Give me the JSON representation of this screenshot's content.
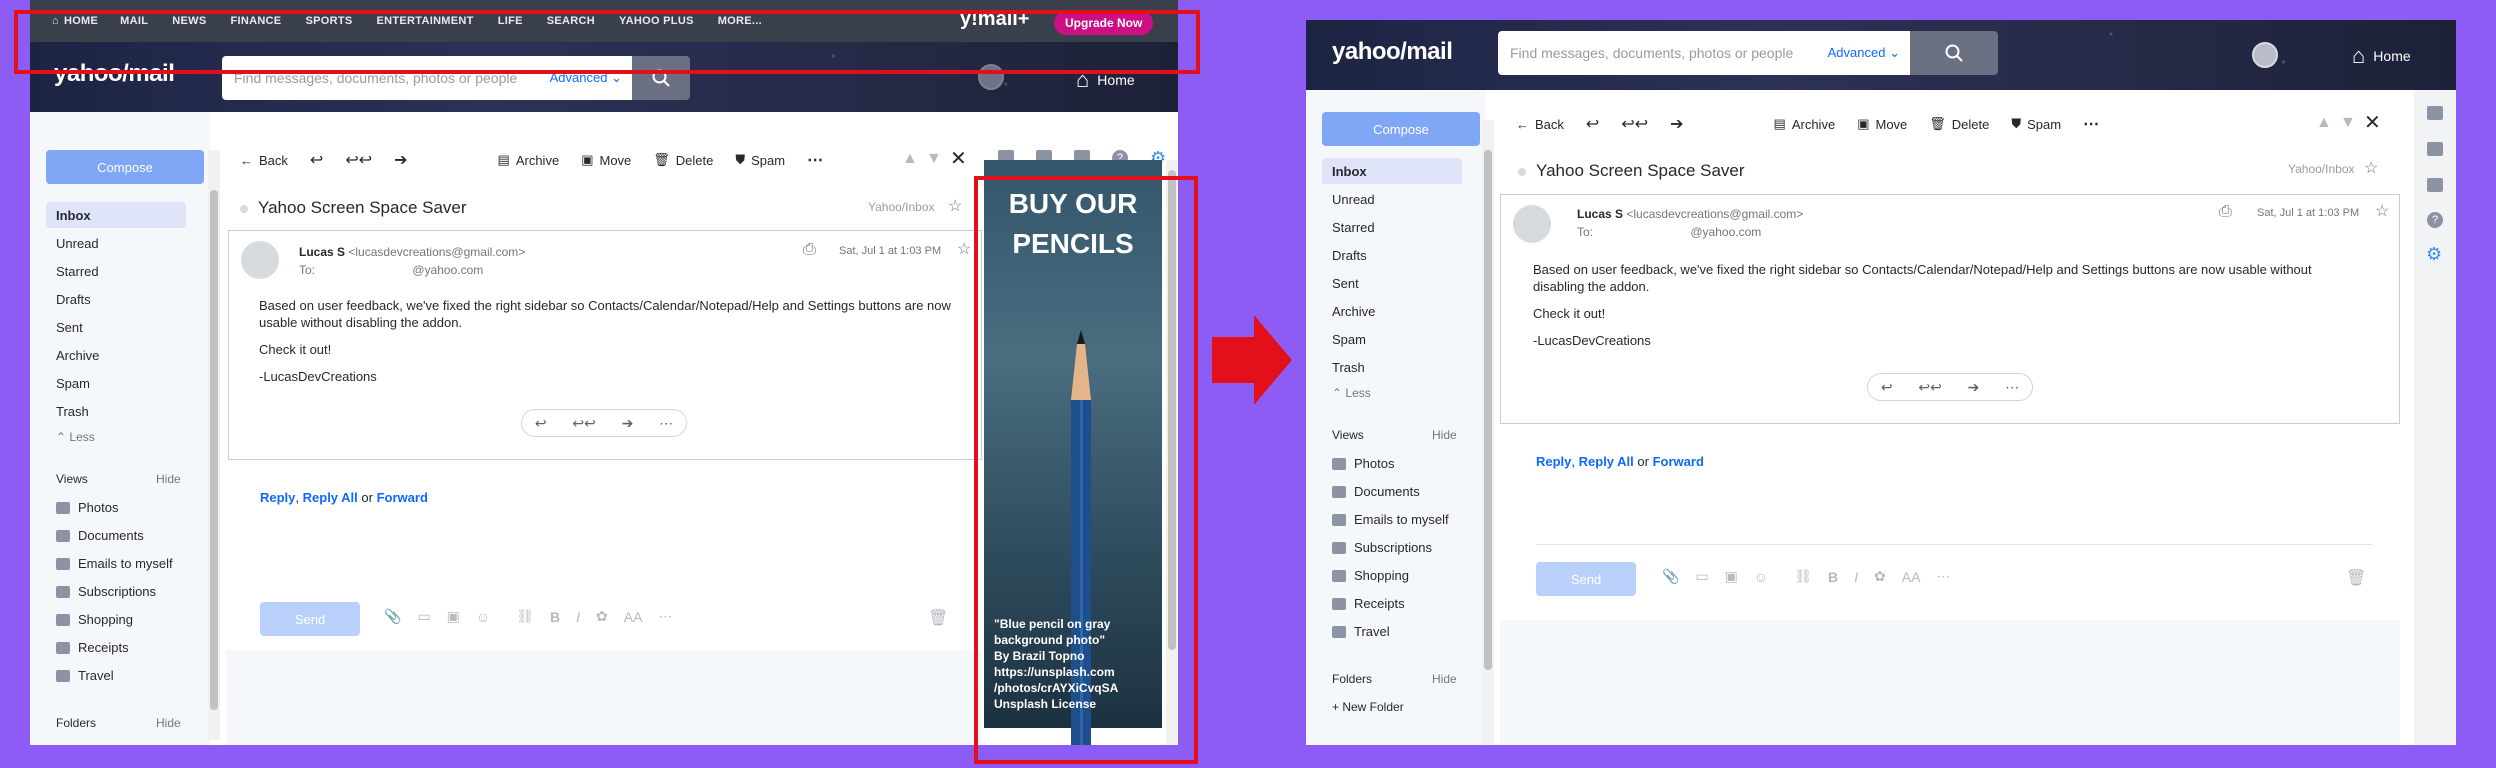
{
  "nav": {
    "items": [
      "HOME",
      "MAIL",
      "NEWS",
      "FINANCE",
      "SPORTS",
      "ENTERTAINMENT",
      "LIFE",
      "SEARCH",
      "YAHOO PLUS",
      "MORE..."
    ],
    "brand": "y!mail+",
    "upgrade": "Upgrade Now"
  },
  "header": {
    "logo": "yahoo/mail",
    "search_placeholder": "Find messages, documents, photos or people",
    "advanced": "Advanced",
    "home": "Home"
  },
  "sidebar": {
    "compose": "Compose",
    "folders": [
      "Inbox",
      "Unread",
      "Starred",
      "Drafts",
      "Sent",
      "Archive",
      "Spam",
      "Trash"
    ],
    "less": "Less",
    "views_label": "Views",
    "hide": "Hide",
    "views": [
      "Photos",
      "Documents",
      "Emails to myself",
      "Subscriptions",
      "Shopping",
      "Receipts",
      "Travel"
    ],
    "folders_label": "Folders",
    "new_folder": "+ New Folder"
  },
  "toolbar": {
    "back": "Back",
    "archive": "Archive",
    "move": "Move",
    "delete": "Delete",
    "spam": "Spam"
  },
  "email": {
    "subject": "Yahoo Screen Space Saver",
    "folder": "Yahoo/Inbox",
    "sender": "Lucas S",
    "sender_email": "<lucasdevcreations@gmail.com>",
    "to_label": "To:",
    "to": "@yahoo.com",
    "date": "Sat, Jul 1 at 1:03 PM",
    "body1": "Based on user feedback, we've fixed the right sidebar so Contacts/Calendar/Notepad/Help and Settings buttons are now usable without disabling the addon.",
    "body2": "Check it out!",
    "sign": "-LucasDevCreations"
  },
  "reply": {
    "reply": "Reply",
    "reply_all": "Reply All",
    "or": "or",
    "forward": "Forward",
    "send": "Send"
  },
  "ad": {
    "title": "BUY OUR PENCILS",
    "caption": "\"Blue pencil on gray\n background photo\"\nBy Brazil Topno\nhttps://unsplash.com\n/photos/crAYXiCvqSA\nUnsplash License"
  },
  "colors": {
    "annotation": "#e3101c",
    "accent": "#0f69ff",
    "compose": "#80a6f6",
    "background": "#8d5cf4"
  }
}
